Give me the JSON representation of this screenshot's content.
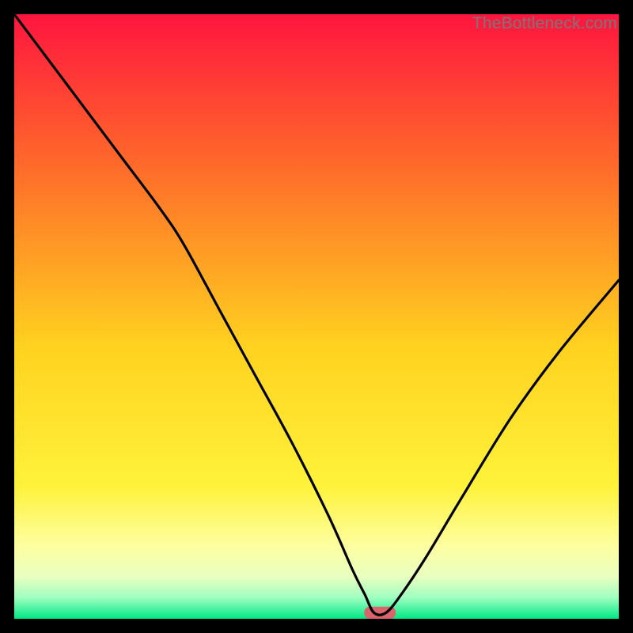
{
  "watermark": "TheBottleneck.com",
  "colors": {
    "grad_top": "#ff153f",
    "grad_upper": "#ff6a2a",
    "grad_mid": "#ffd21f",
    "grad_lower1": "#fff23a",
    "grad_lower2": "#fdffa0",
    "grad_lower3": "#e9ffc0",
    "grad_lower4": "#9fffc0",
    "grad_bottom": "#00e884",
    "curve": "#000000",
    "marker": "#d9646b"
  },
  "chart_data": {
    "type": "line",
    "title": "",
    "xlabel": "",
    "ylabel": "",
    "xlim": [
      0,
      100
    ],
    "ylim": [
      0,
      100
    ],
    "series": [
      {
        "name": "bottleneck-curve",
        "x": [
          0,
          6,
          12,
          18,
          24,
          28,
          34,
          40,
          46,
          52,
          56,
          58,
          59.5,
          61.5,
          64,
          68,
          74,
          82,
          90,
          100
        ],
        "y": [
          100,
          92,
          84,
          76,
          68,
          62,
          51,
          40,
          29,
          17,
          8,
          4,
          1,
          1,
          4,
          10,
          20,
          33,
          44,
          56
        ]
      }
    ],
    "marker": {
      "x_center": 60.5,
      "y": 1.0,
      "width": 5.2,
      "height": 2.0
    }
  }
}
